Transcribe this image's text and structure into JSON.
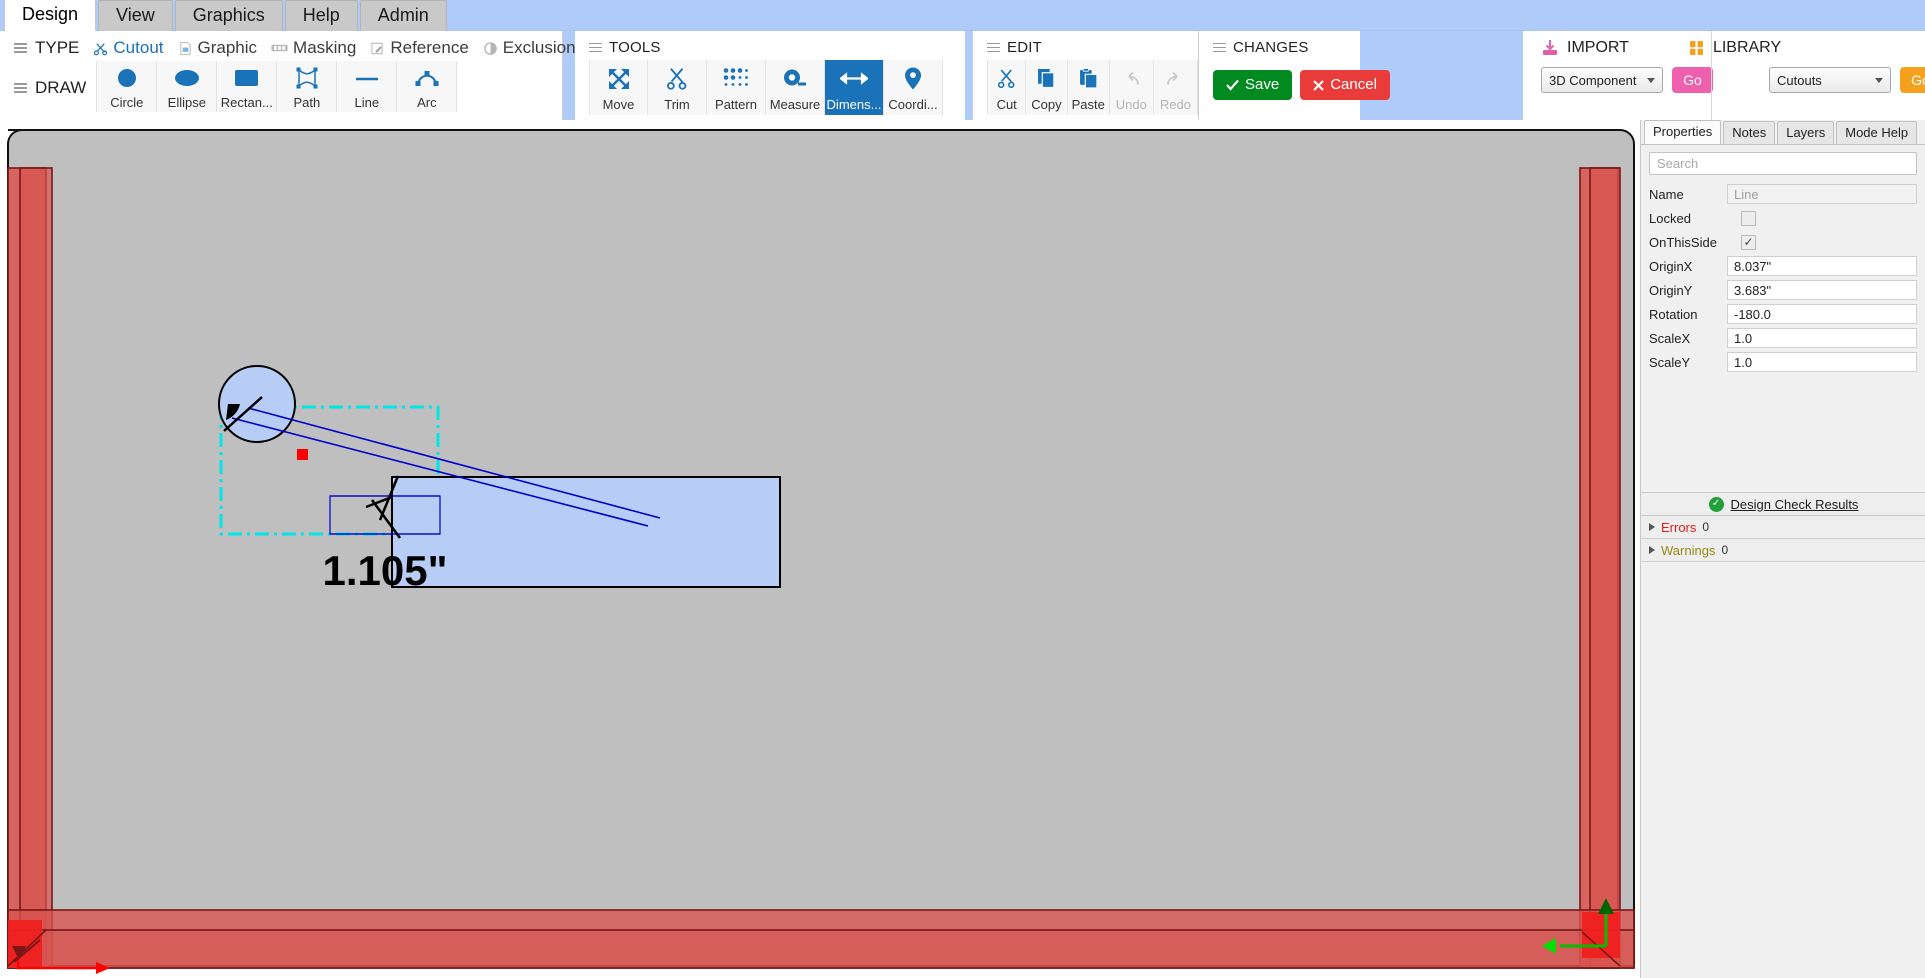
{
  "menubar": {
    "tabs": [
      {
        "label": "Design",
        "active": true
      },
      {
        "label": "View",
        "active": false
      },
      {
        "label": "Graphics",
        "active": false
      },
      {
        "label": "Help",
        "active": false
      },
      {
        "label": "Admin",
        "active": false
      }
    ]
  },
  "ribbon": {
    "design_group": {
      "type_label": "TYPE",
      "type_items": [
        {
          "label": "Cutout",
          "icon": "scissors-icon",
          "active": true
        },
        {
          "label": "Graphic",
          "icon": "image-file-icon",
          "active": false
        },
        {
          "label": "Masking",
          "icon": "masking-tape-icon",
          "active": false
        },
        {
          "label": "Reference",
          "icon": "edit-square-icon",
          "active": false
        },
        {
          "label": "Exclusion",
          "icon": "half-circle-icon",
          "active": false
        }
      ],
      "draw_label": "DRAW",
      "draw_items": [
        {
          "label": "Circle",
          "icon": "circle-icon"
        },
        {
          "label": "Ellipse",
          "icon": "ellipse-icon"
        },
        {
          "label": "Rectan...",
          "icon": "rectangle-icon"
        },
        {
          "label": "Path",
          "icon": "path-icon"
        },
        {
          "label": "Line",
          "icon": "line-icon"
        },
        {
          "label": "Arc",
          "icon": "arc-icon"
        }
      ]
    },
    "tools_group": {
      "title": "TOOLS",
      "items": [
        {
          "label": "Move",
          "icon": "move-arrows-icon",
          "active": false,
          "disabled": false
        },
        {
          "label": "Trim",
          "icon": "scissors-icon",
          "active": false,
          "disabled": false
        },
        {
          "label": "Pattern",
          "icon": "dot-grid-icon",
          "active": false,
          "disabled": false
        },
        {
          "label": "Measure",
          "icon": "tape-measure-icon",
          "active": false,
          "disabled": false
        },
        {
          "label": "Dimens...",
          "icon": "dimension-arrow-icon",
          "active": true,
          "disabled": false
        },
        {
          "label": "Coordi...",
          "icon": "map-pin-icon",
          "active": false,
          "disabled": false
        }
      ]
    },
    "edit_group": {
      "title": "EDIT",
      "items": [
        {
          "label": "Cut",
          "icon": "scissors-icon",
          "disabled": false
        },
        {
          "label": "Copy",
          "icon": "copy-icon",
          "disabled": false
        },
        {
          "label": "Paste",
          "icon": "paste-icon",
          "disabled": false
        },
        {
          "label": "Undo",
          "icon": "undo-arrow-icon",
          "disabled": true
        },
        {
          "label": "Redo",
          "icon": "redo-arrow-icon",
          "disabled": true
        }
      ]
    },
    "changes_group": {
      "title": "CHANGES",
      "save_label": "Save",
      "cancel_label": "Cancel",
      "save_color": "#008a20",
      "cancel_color": "#ea3b3b"
    },
    "import_group": {
      "title": "IMPORT",
      "icon": "download-tray-icon",
      "select_value": "3D Component",
      "go_label": "Go",
      "go_color": "#ee5fae"
    },
    "library_group": {
      "title": "LIBRARY",
      "icon": "grid-blocks-icon",
      "select_value": "Cutouts",
      "go_label": "Go",
      "go_color": "#f5a11e"
    }
  },
  "canvas": {
    "background_color": "#bfbfbf",
    "exclusion_color": "#d9534f",
    "shape_fill": "#b7cdf5",
    "selection_color": "#00e5e5",
    "dimension_label": "1.105\"",
    "dimension_color": "#0000cd",
    "origin_handle_color": "#ff0000",
    "axis_marker_colors": {
      "x": "#ff0000",
      "y": "#00e000"
    }
  },
  "rightpanel": {
    "tabs": [
      {
        "label": "Properties",
        "active": true
      },
      {
        "label": "Notes",
        "active": false
      },
      {
        "label": "Layers",
        "active": false
      },
      {
        "label": "Mode Help",
        "active": false
      }
    ],
    "search_placeholder": "Search",
    "search_value": "",
    "properties": [
      {
        "label": "Name",
        "type": "text",
        "value": "Line",
        "readonly": true
      },
      {
        "label": "Locked",
        "type": "checkbox",
        "checked": false
      },
      {
        "label": "OnThisSide",
        "type": "checkbox",
        "checked": true
      },
      {
        "label": "OriginX",
        "type": "text",
        "value": "8.037\"",
        "readonly": false
      },
      {
        "label": "OriginY",
        "type": "text",
        "value": "3.683\"",
        "readonly": false
      },
      {
        "label": "Rotation",
        "type": "text",
        "value": "-180.0",
        "readonly": false
      },
      {
        "label": "ScaleX",
        "type": "text",
        "value": "1.0",
        "readonly": false
      },
      {
        "label": "ScaleY",
        "type": "text",
        "value": "1.0",
        "readonly": false
      }
    ],
    "design_check": {
      "title": "Design Check Results",
      "status_icon": "green-check-icon",
      "rows": [
        {
          "name": "Errors",
          "count": "0",
          "color": "#e01b1b"
        },
        {
          "name": "Warnings",
          "count": "0",
          "color": "#9a8a14"
        }
      ]
    }
  }
}
